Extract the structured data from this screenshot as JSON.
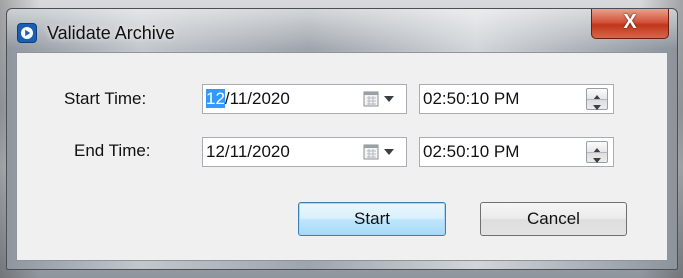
{
  "window": {
    "title": "Validate Archive",
    "close_glyph": "X"
  },
  "form": {
    "start": {
      "label": "Start Time:",
      "date_selected": "12",
      "date_rest": "/11/2020",
      "time": "02:50:10 PM"
    },
    "end": {
      "label": "End Time:",
      "date": "12/11/2020",
      "time": "02:50:10 PM"
    }
  },
  "buttons": {
    "start_label": "Start",
    "cancel_label": "Cancel"
  },
  "icons": {
    "app": "app-logo-icon",
    "calendar": "calendar-dropdown-icon",
    "spin_up": "spin-up-arrow-icon",
    "spin_down": "spin-down-arrow-icon"
  },
  "colors": {
    "close_button": "#c0361c",
    "selection": "#3399ff",
    "default_button_border": "#3c7fb1"
  }
}
